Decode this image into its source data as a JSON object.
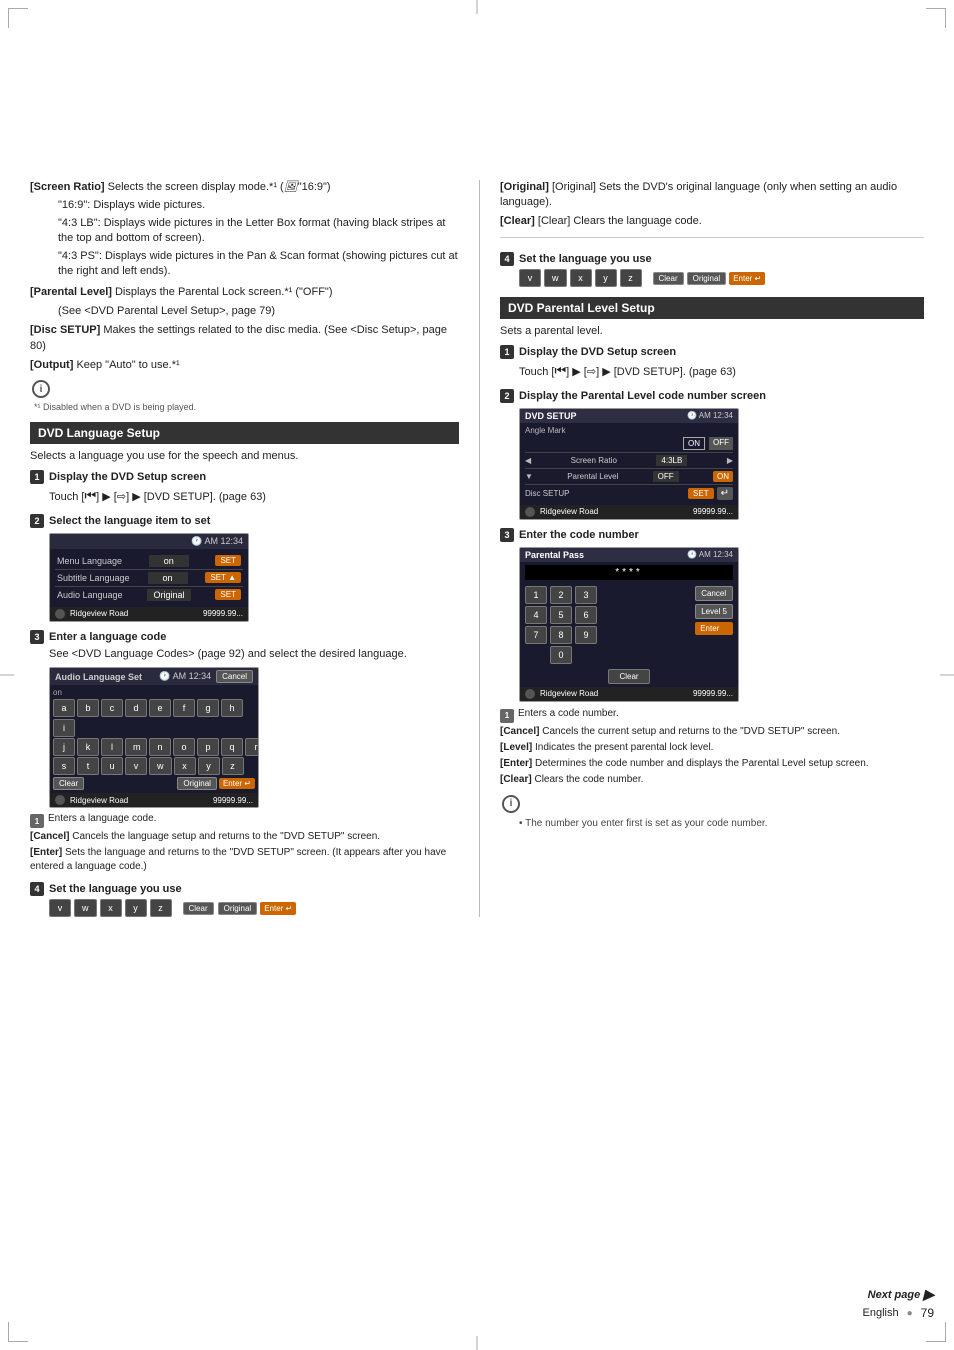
{
  "page": {
    "number": "79",
    "language": "English",
    "next_page_label": "Next page"
  },
  "left_column": {
    "top_items": [
      {
        "label": "[Screen Ratio]",
        "desc": "Selects the screen display mode.*¹ (\"16:9\")",
        "sub_items": [
          "\"16:9\": Displays wide pictures.",
          "\"4:3 LB\": Displays wide pictures in the Letter Box format (having black stripes at the top and bottom of screen).",
          "\"4:3 PS\": Displays wide pictures in the Pan & Scan format (showing pictures cut at the right and left ends)."
        ]
      },
      {
        "label": "[Parental Level]",
        "desc": "Displays the Parental Lock screen.*¹ (\"OFF\")",
        "sub_items": [
          "(See <DVD Parental Level Setup>, page 79)"
        ]
      },
      {
        "label": "[Disc SETUP]",
        "desc": "Makes the settings related to the disc media. (See <Disc Setup>, page 80)"
      },
      {
        "label": "[Output]",
        "desc": "Keep \"Auto\" to use.*¹"
      }
    ],
    "asterisk_note": "*¹ Disabled when a DVD is being played.",
    "dvd_language_setup": {
      "section_title": "DVD Language Setup",
      "intro": "Selects a language you use for the speech and menus.",
      "steps": [
        {
          "num": "1",
          "title": "Display the DVD Setup screen",
          "desc": "Touch [⏮] ▶ [⇨] ▶ [DVD SETUP]. (page 63)"
        },
        {
          "num": "2",
          "title": "Select the language item to set",
          "screen": {
            "header_left": "",
            "header_right": "🕐 AM 12:34",
            "rows": [
              {
                "label": "Menu Language",
                "value": "on",
                "btn": "SET"
              },
              {
                "label": "Subtitle Language",
                "value": "on",
                "btn": "SET"
              },
              {
                "label": "Audio Language",
                "value": "Original",
                "btn": "SET"
              }
            ],
            "footer": ""
          }
        },
        {
          "num": "3",
          "title": "Enter a language code",
          "desc": "See <DVD Language Codes> (page 92) and select the desired language.",
          "screen": {
            "header_right": "🕐 AM 12:34",
            "header_btn": "Cancel",
            "row_label": "on",
            "keys_row1": [
              "a",
              "b",
              "c",
              "d",
              "e",
              "f",
              "g",
              "h",
              "i"
            ],
            "keys_row2": [
              "j",
              "k",
              "l",
              "m",
              "n",
              "o",
              "p",
              "q",
              "r"
            ],
            "keys_row3": [
              "s",
              "t",
              "u",
              "v",
              "w",
              "x",
              "y",
              "z"
            ],
            "keys_row4": [
              "",
              "",
              "",
              "",
              "",
              "",
              "",
              "",
              ""
            ],
            "btn_clear": "Clear",
            "btn_original": "Original",
            "btn_enter": "Enter",
            "footer_road": "Ridgeview Road",
            "footer_num": "99999.99..."
          },
          "notes": [
            {
              "num": "1",
              "text": "Enters a language code."
            },
            {
              "label": "[Cancel]",
              "text": "Cancels the language setup and returns to the \"DVD SETUP\" screen."
            },
            {
              "label": "[Enter]",
              "text": "Sets the language and returns to the \"DVD SETUP\" screen. (It appears after you have entered a language code.)"
            }
          ]
        }
      ]
    },
    "set_language_step": {
      "num": "4",
      "title": "Set the language you use",
      "keys": [
        "v",
        "w",
        "x",
        "y",
        "z"
      ],
      "btn_clear": "Clear",
      "btn_original": "Original",
      "btn_enter": "Enter",
      "original_desc": "[Original]  Sets the DVD's original language (only when setting an audio language).",
      "clear_desc": "[Clear]  Clears the language code."
    }
  },
  "right_column": {
    "dvd_parental_level_setup": {
      "section_title": "DVD Parental Level Setup",
      "intro": "Sets a parental level.",
      "steps": [
        {
          "num": "1",
          "title": "Display the DVD Setup screen",
          "desc": "Touch [⏮] ▶ [⇨] ▶ [DVD SETUP]. (page 63)"
        },
        {
          "num": "2",
          "title": "Display the Parental Level code number screen",
          "screen": {
            "header_right": "🕐 AM 12:34",
            "title_bar": "DVD SETUP",
            "angle_mark": "Angle Mark",
            "on": "ON",
            "off": "OFF",
            "screen_ratio_label": "Screen Ratio",
            "screen_ratio_value": "4:3LB",
            "parental_label": "Parental Level",
            "parental_value": "OFF",
            "disc_setup_label": "Disc SETUP",
            "disc_btn": "SET",
            "footer_road": "Ridgeview Road",
            "footer_num": "99999.99..."
          }
        },
        {
          "num": "3",
          "title": "Enter the code number",
          "screen": {
            "header_right": "🕐 AM 12:34",
            "title_bar": "Parental Pass",
            "pass_display": "****",
            "keys_row1": [
              "1",
              "2",
              "3"
            ],
            "keys_row2": [
              "4",
              "5",
              "6"
            ],
            "keys_row3": [
              "7",
              "8",
              "9"
            ],
            "keys_row4": [
              "",
              "0",
              ""
            ],
            "btn_cancel": "Cancel",
            "btn_level5": "Level 5",
            "btn_enter": "Enter",
            "btn_clear": "Clear",
            "footer_road": "Ridgeview Road",
            "footer_num": "99999.99..."
          },
          "notes": [
            {
              "num": "1",
              "text": "Enters a code number."
            },
            {
              "label": "[Cancel]",
              "text": "Cancels the current setup and returns to the \"DVD SETUP\" screen."
            },
            {
              "label": "[Level]",
              "text": "Indicates the present parental lock level."
            },
            {
              "label": "[Enter]",
              "text": "Determines the code number and displays the Parental Level setup screen."
            },
            {
              "label": "[Clear]",
              "text": "Clears the code number."
            }
          ]
        }
      ],
      "info_note": "• The number you enter first is set as your code number."
    }
  }
}
